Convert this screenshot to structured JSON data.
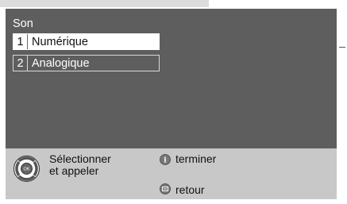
{
  "menu": {
    "title": "Son",
    "items": [
      {
        "number": "1",
        "label": "Numérique",
        "selected": true
      },
      {
        "number": "2",
        "label": "Analogique",
        "selected": false
      }
    ]
  },
  "footer": {
    "select_label_line1": "Sélectionner",
    "select_label_line2": "et appeler",
    "info_label": "terminer",
    "back_label": "retour"
  }
}
